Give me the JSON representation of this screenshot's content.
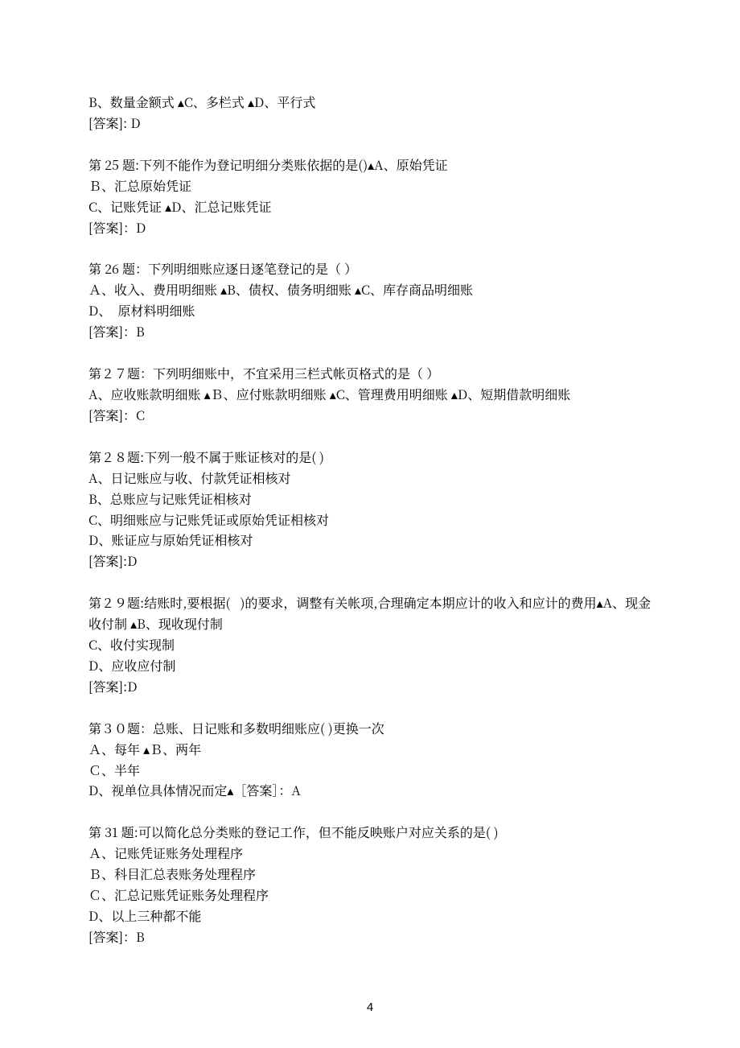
{
  "page_number": "4",
  "q24_tail": {
    "options_line": "B、数量金额式 ▴C、多栏式 ▴D、平行式",
    "answer_line": "[答案]: D"
  },
  "q25": {
    "title": "第 25 题:下列不能作为登记明细分类账依据的是()▴A、原始凭证",
    "opt_b": "Ｂ、汇总原始凭证",
    "opt_cd": "C、记账凭证 ▴D、汇总记账凭证",
    "answer": "[答案]：D"
  },
  "q26": {
    "title": "第 26 题：下列明细账应逐日逐笔登记的是（ ）",
    "opt_abc": "Ａ、收入、费用明细账 ▴B、债权、债务明细账 ▴C、库存商品明细账",
    "opt_d": "D、  原材料明细账",
    "answer": "[答案]：B"
  },
  "q27": {
    "title": "第２７题：下列明细账中，不宜采用三栏式帐页格式的是（ ）",
    "opts": "A、应收账款明细账 ▴Ｂ、应付账款明细账 ▴C、管理费用明细账 ▴D、短期借款明细账",
    "answer": "[答案]：C"
  },
  "q28": {
    "title": "第２８题:下列一般不属于账证核对的是( )",
    "opt_a": "A、日记账应与收、付款凭证相核对",
    "opt_b": "B、总账应与记账凭证相核对",
    "opt_c": "C、明细账应与记账凭证或原始凭证相核对",
    "opt_d": "D、账证应与原始凭证相核对",
    "answer": "[答案]:D"
  },
  "q29": {
    "title": "第２９题:结账时,要根据(   )的要求，调整有关帐项,合理确定本期应计的收入和应计的费用▴A、现金收付制 ▴B、现收现付制",
    "opt_c": "C、收付实现制",
    "opt_d": "D、应收应付制",
    "answer": "[答案]:D"
  },
  "q30": {
    "title": "第３０题：总账、日记账和多数明细账应( )更换一次",
    "opt_ab": "Ａ、每年 ▴Ｂ、两年",
    "opt_c": "Ｃ、半年",
    "opt_d_ans": "D、视单位具体情况而定▴［答案］：A"
  },
  "q31": {
    "title": "第 31 题:可以简化总分类账的登记工作，但不能反映账户对应关系的是( )",
    "opt_a": "Ａ、记账凭证账务处理程序",
    "opt_b": "Ｂ、科目汇总表账务处理程序",
    "opt_c": "Ｃ、汇总记账凭证账务处理程序",
    "opt_d": "D、以上三种都不能",
    "answer": "[答案]：B"
  }
}
